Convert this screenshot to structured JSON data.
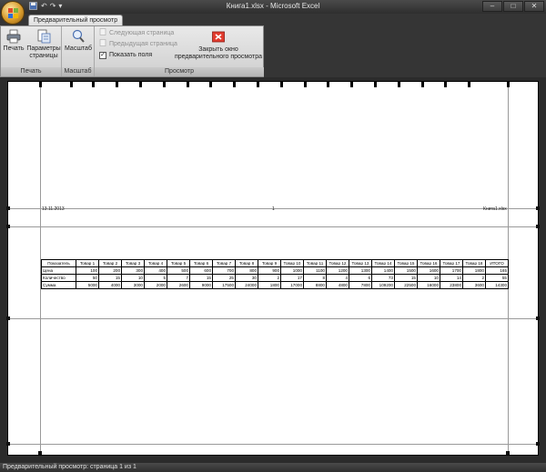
{
  "window": {
    "title": "Книга1.xlsx - Microsoft Excel",
    "controls": [
      "–",
      "□",
      "✕"
    ]
  },
  "quick_access": {
    "save_icon": "save-icon",
    "undo": "↶",
    "redo": "↷",
    "customize": "▾"
  },
  "ribbon": {
    "tab_label": "Предварительный просмотр",
    "groups": {
      "print": {
        "label": "Печать",
        "print_button": "Печать",
        "page_setup_button": "Параметры страницы"
      },
      "zoom": {
        "label": "Масштаб",
        "zoom_button": "Масштаб"
      },
      "preview": {
        "label": "Просмотр",
        "next_page": "Следующая страница",
        "prev_page": "Предыдущая страница",
        "show_margins": "Показать поля",
        "show_margins_checked": "✓",
        "close_preview": "Закрыть окно предварительного просмотра"
      }
    }
  },
  "page": {
    "header_left": "13.11.2013",
    "header_center": "1",
    "header_right": "Книга1.xlsx"
  },
  "table": {
    "header": [
      "Показатель",
      "Товар 1",
      "Товар 2",
      "Товар 3",
      "Товар 4",
      "Товар 5",
      "Товар 6",
      "Товар 7",
      "Товар 8",
      "Товар 9",
      "Товар 10",
      "Товар 11",
      "Товар 12",
      "Товар 13",
      "Товар 14",
      "Товар 15",
      "Товар 16",
      "Товар 17",
      "Товар 18",
      "ИТОГО"
    ],
    "rows": [
      [
        "Цена",
        "100",
        "200",
        "300",
        "400",
        "500",
        "600",
        "700",
        "800",
        "900",
        "1000",
        "1100",
        "1200",
        "1300",
        "1400",
        "1500",
        "1600",
        "1700",
        "1800",
        "165"
      ],
      [
        "Количество",
        "50",
        "15",
        "10",
        "5",
        "7",
        "15",
        "25",
        "30",
        "2",
        "17",
        "8",
        "4",
        "6",
        "73",
        "15",
        "10",
        "14",
        "2",
        "55"
      ],
      [
        "Сумма",
        "5000",
        "4000",
        "3000",
        "2000",
        "2600",
        "9000",
        "17500",
        "24000",
        "1800",
        "17000",
        "8800",
        "4800",
        "7800",
        "109200",
        "22500",
        "16000",
        "23800",
        "3600",
        "14300"
      ]
    ]
  },
  "status": {
    "text": "Предварительный просмотр: страница 1 из 1"
  }
}
